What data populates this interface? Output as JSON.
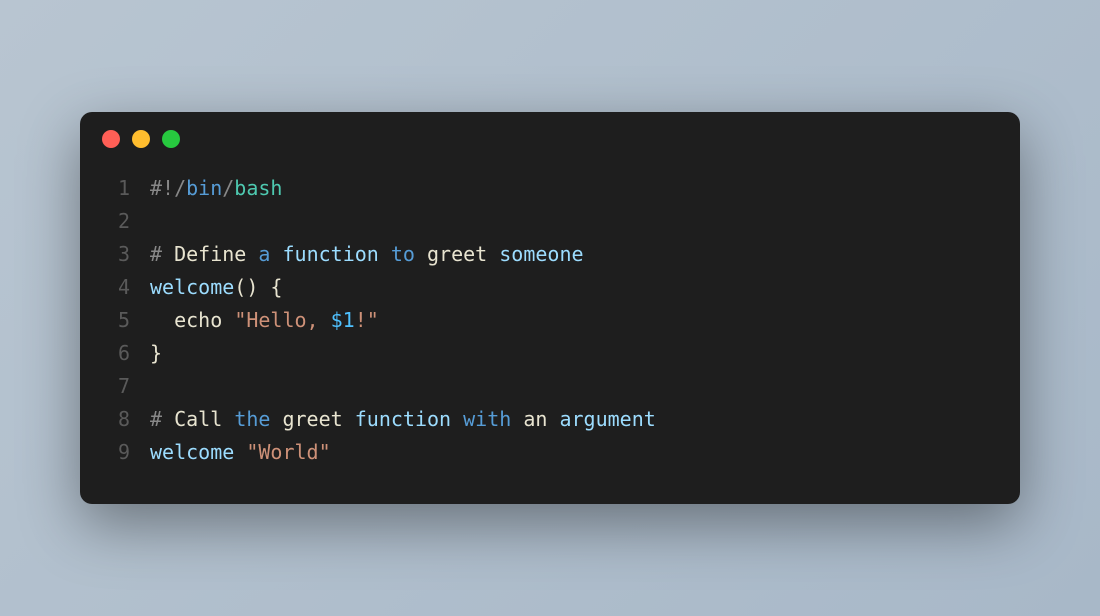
{
  "traffic_lights": {
    "red": "#ff5f56",
    "yellow": "#ffbd2e",
    "green": "#27c93f"
  },
  "code": {
    "line_numbers": [
      "1",
      "2",
      "3",
      "4",
      "5",
      "6",
      "7",
      "8",
      "9"
    ],
    "lines": [
      [
        {
          "text": "#!/",
          "cls": "tok-gray"
        },
        {
          "text": "bin",
          "cls": "tok-blue"
        },
        {
          "text": "/",
          "cls": "tok-gray"
        },
        {
          "text": "bash",
          "cls": "tok-cyan"
        }
      ],
      [],
      [
        {
          "text": "# ",
          "cls": "tok-gray"
        },
        {
          "text": "Define ",
          "cls": "tok-cream"
        },
        {
          "text": "a",
          "cls": "tok-blue"
        },
        {
          "text": " ",
          "cls": "tok-cream"
        },
        {
          "text": "function",
          "cls": "tok-lightblue"
        },
        {
          "text": " ",
          "cls": "tok-cream"
        },
        {
          "text": "to",
          "cls": "tok-blue"
        },
        {
          "text": " greet ",
          "cls": "tok-cream"
        },
        {
          "text": "someone",
          "cls": "tok-lightblue"
        }
      ],
      [
        {
          "text": "welcome",
          "cls": "tok-lightblue"
        },
        {
          "text": "() {",
          "cls": "tok-cream"
        }
      ],
      [
        {
          "text": "  ",
          "cls": "tok-cream"
        },
        {
          "text": "echo",
          "cls": "tok-cream"
        },
        {
          "text": " ",
          "cls": "tok-cream"
        },
        {
          "text": "\"Hello, ",
          "cls": "tok-string"
        },
        {
          "text": "$1",
          "cls": "tok-var"
        },
        {
          "text": "!\"",
          "cls": "tok-string"
        }
      ],
      [
        {
          "text": "}",
          "cls": "tok-cream"
        }
      ],
      [],
      [
        {
          "text": "# ",
          "cls": "tok-gray"
        },
        {
          "text": "Call ",
          "cls": "tok-cream"
        },
        {
          "text": "the",
          "cls": "tok-blue"
        },
        {
          "text": " greet ",
          "cls": "tok-cream"
        },
        {
          "text": "function",
          "cls": "tok-lightblue"
        },
        {
          "text": " ",
          "cls": "tok-cream"
        },
        {
          "text": "with",
          "cls": "tok-blue"
        },
        {
          "text": " an ",
          "cls": "tok-cream"
        },
        {
          "text": "argument",
          "cls": "tok-lightblue"
        }
      ],
      [
        {
          "text": "welcome ",
          "cls": "tok-lightblue"
        },
        {
          "text": "\"World\"",
          "cls": "tok-string"
        }
      ]
    ]
  }
}
